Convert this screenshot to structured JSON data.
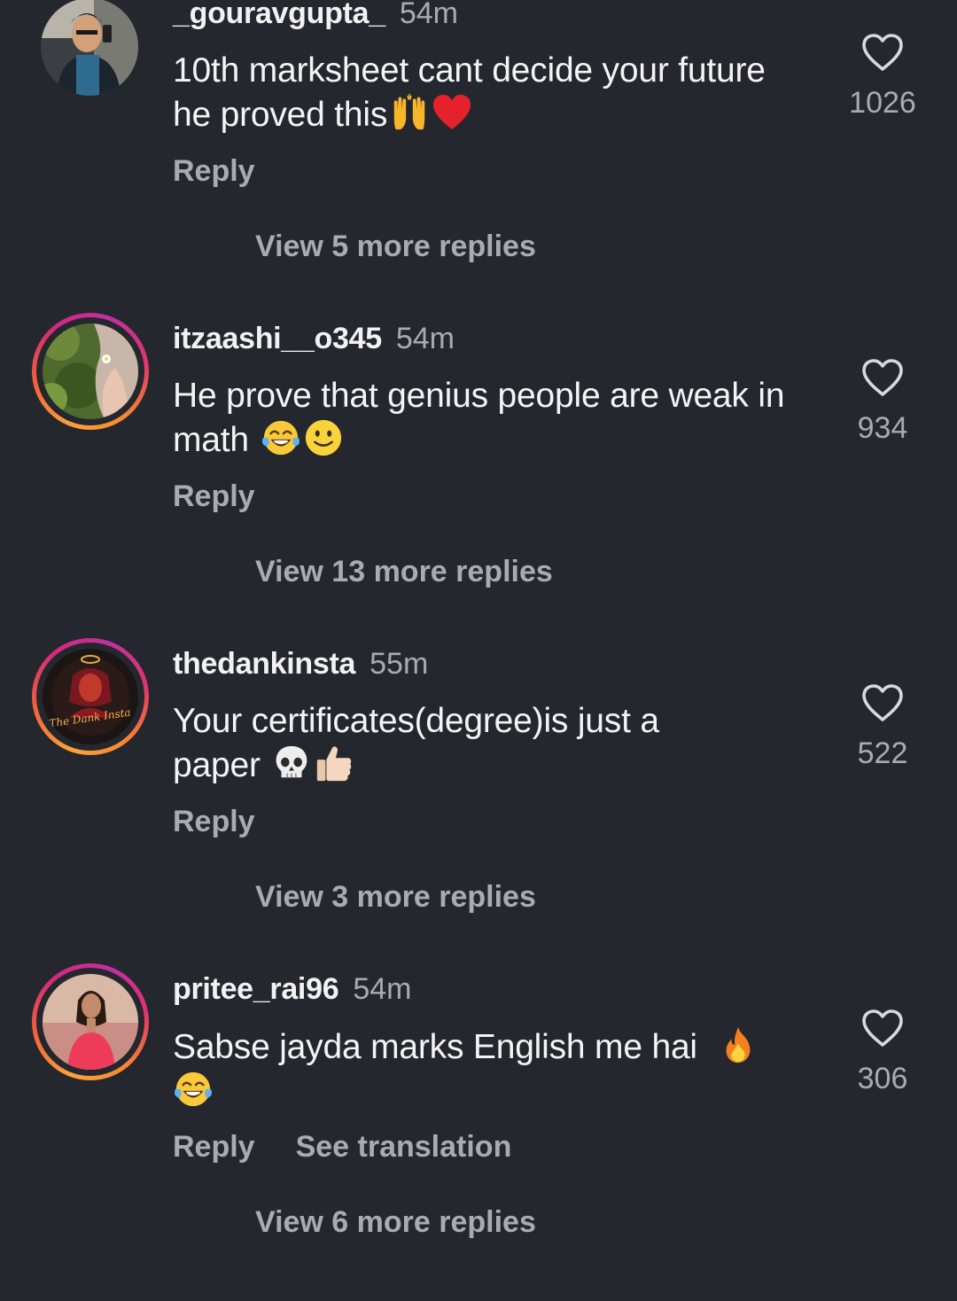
{
  "comments": [
    {
      "username": "_gouravgupta_",
      "time": "54m",
      "text": "10th marksheet cant decide your future he proved this",
      "emojis": [
        "raising-hands",
        "red-heart"
      ],
      "reply_label": "Reply",
      "likes": "1026",
      "view_replies": "View 5 more replies",
      "avatar": "profile-photo-man-selfie"
    },
    {
      "username": "itzaashi__o345",
      "time": "54m",
      "text": "He prove that genius people are weak in math",
      "emojis": [
        "tears-of-joy",
        "slightly-smiling-face"
      ],
      "reply_label": "Reply",
      "likes": "934",
      "view_replies": "View 13 more replies",
      "avatar": "profile-photo-flower-greenery",
      "story_ring": true
    },
    {
      "username": "thedankinsta",
      "time": "55m",
      "text": "Your certificates(degree)is just a paper",
      "emojis": [
        "skull",
        "thumbs-up"
      ],
      "reply_label": "Reply",
      "likes": "522",
      "view_replies": "View 3 more replies",
      "avatar": "profile-logo-the-dank-insta",
      "avatar_logo_text": "The Dank Insta",
      "story_ring": true
    },
    {
      "username": "pritee_rai96",
      "time": "54m",
      "text": "Sabse jayda marks English me hai",
      "emojis": [
        "fire",
        "tears-of-joy"
      ],
      "reply_label": "Reply",
      "translation_label": "See translation",
      "likes": "306",
      "view_replies": "View 6 more replies",
      "avatar": "profile-photo-woman-pink-dress",
      "story_ring": true
    }
  ],
  "colors": {
    "background": "#25272e",
    "primary_text": "#f4f4f4",
    "secondary_text": "#a9abb2",
    "story_ring": [
      "#f9a33a",
      "#d4297a"
    ]
  }
}
